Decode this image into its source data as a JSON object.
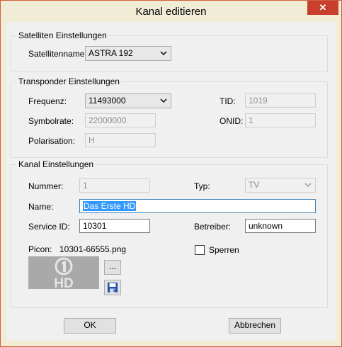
{
  "window": {
    "title": "Kanal editieren",
    "close_label": "✕"
  },
  "satellite": {
    "legend": "Satelliten Einstellungen",
    "name_label": "Satellitenname:",
    "name_value": "ASTRA 192"
  },
  "transponder": {
    "legend": "Transponder Einstellungen",
    "freq_label": "Frequenz:",
    "freq_value": "11493000",
    "symrate_label": "Symbolrate:",
    "symrate_value": "22000000",
    "pol_label": "Polarisation:",
    "pol_value": "H",
    "tid_label": "TID:",
    "tid_value": "1019",
    "onid_label": "ONID:",
    "onid_value": "1"
  },
  "channel": {
    "legend": "Kanal Einstellungen",
    "number_label": "Nummer:",
    "number_value": "1",
    "type_label": "Typ:",
    "type_value": "TV",
    "name_label": "Name:",
    "name_value": "Das Erste HD",
    "sid_label": "Service ID:",
    "sid_value": "10301",
    "operator_label": "Betreiber:",
    "operator_value": "unknown",
    "picon_label": "Picon:",
    "picon_file": "10301-66555.png",
    "browse_label": "...",
    "lock_label": "Sperren",
    "lock_checked": false,
    "logo_text": "HD"
  },
  "buttons": {
    "ok_label": "OK",
    "cancel_label": "Abbrechen"
  },
  "colors": {
    "window_border": "#d15f3e",
    "close_button": "#c8402c",
    "selection": "#3399ff"
  }
}
